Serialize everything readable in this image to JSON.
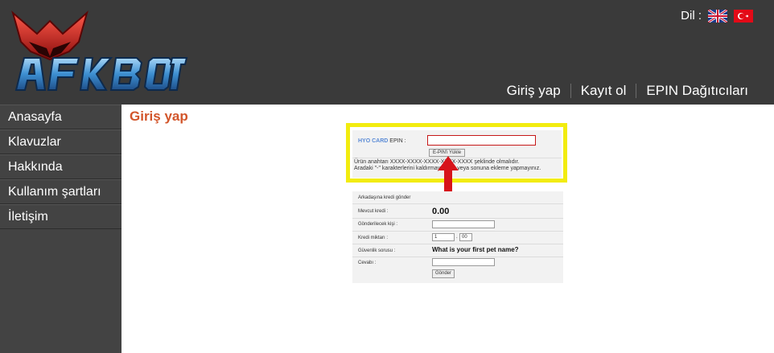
{
  "header": {
    "logo_text": "AFKBOT",
    "language_label": "Dil :",
    "flags": [
      "uk-flag-icon",
      "turkey-flag-icon"
    ]
  },
  "topnav": [
    "Giriş yap",
    "Kayıt ol",
    "EPIN Dağıtıcıları"
  ],
  "sidebar": {
    "items": [
      "Anasayfa",
      "Klavuzlar",
      "Hakkında",
      "Kullanım şartları",
      "İletişim"
    ]
  },
  "main": {
    "title": "Giriş yap",
    "epin": {
      "brand": "HYO CARD",
      "label": "EPIN :",
      "button": "E-PIN'i Yükle",
      "hint_line1": "Ürün anahtarı XXXX-XXXX-XXXX-XXXX-XXXX şeklinde olmalıdır.",
      "hint_line2": "Aradaki \"-\" karakterlerini kaldırmayınız ... veya sonuna ekleme yapmayınız."
    },
    "kredi": {
      "header": "Arkadaşına kredi gönder",
      "balance_label": "Mevcut kredi :",
      "balance_value": "0.00",
      "recipient_label": "Gönderilecek kişi :",
      "amount_label": "Kredi miktarı :",
      "amount_int": "1",
      "amount_dec": "00",
      "question_label": "Güvenlik sorusu :",
      "question_value": "What is your first pet name?",
      "answer_label": "Cevabı :",
      "submit": "Gönder"
    }
  },
  "colors": {
    "header_bg": "#3a3a3a",
    "sidebar_bg": "#434343",
    "title_color": "#d2552a",
    "highlight": "#f2ec0f",
    "arrow": "#d7141a"
  }
}
